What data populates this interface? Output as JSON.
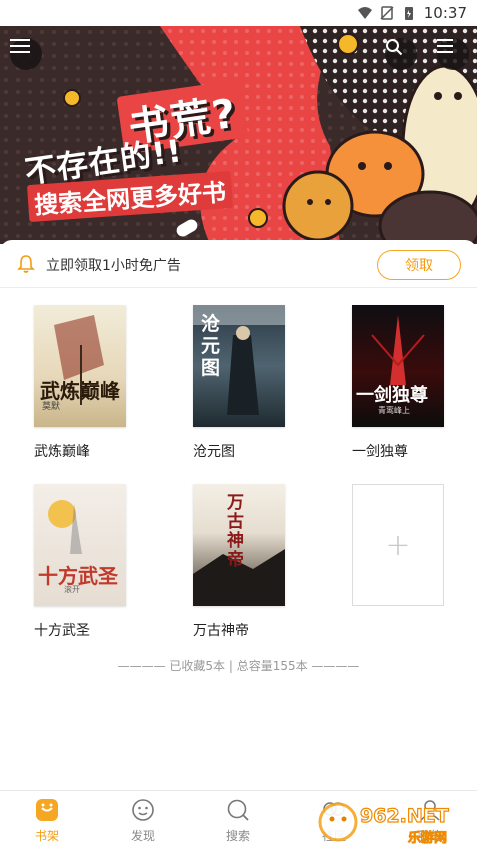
{
  "status_bar": {
    "time": "10:37",
    "icons": [
      "wifi-icon",
      "no-sim-icon",
      "battery-icon"
    ]
  },
  "banner": {
    "line1": "书荒?",
    "line2": "不存在的!!",
    "line3": "搜索全网更多好书",
    "buttons": [
      "menu-icon",
      "search-icon",
      "more-icon"
    ]
  },
  "notice": {
    "text": "立即领取1小时免广告",
    "button": "领取"
  },
  "books": [
    {
      "title": "武炼巅峰",
      "cover_text": "武炼巅峰",
      "cover_sub": "莫默"
    },
    {
      "title": "沧元图",
      "cover_text": "沧元图",
      "cover_sub": ""
    },
    {
      "title": "一剑独尊",
      "cover_text": "一剑独尊",
      "cover_sub": "青鸾峰上"
    },
    {
      "title": "十方武圣",
      "cover_text": "十方武圣",
      "cover_sub": "滚开"
    },
    {
      "title": "万古神帝",
      "cover_text": "万古神帝",
      "cover_sub": ""
    }
  ],
  "add_book": {
    "glyph": "+"
  },
  "summary": "———— 已收藏5本 | 总容量155本 ————",
  "bottom_nav": [
    {
      "label": "书架",
      "icon": "bookshelf-icon",
      "active": true
    },
    {
      "label": "发现",
      "icon": "discover-icon",
      "active": false
    },
    {
      "label": "搜索",
      "icon": "search-icon",
      "active": false
    },
    {
      "label": "社区",
      "icon": "community-icon",
      "active": false
    },
    {
      "label": "我的",
      "icon": "profile-icon",
      "active": false
    }
  ],
  "watermark": {
    "line1": "962.NET",
    "line2": "乐游网"
  },
  "colors": {
    "accent": "#f39c12",
    "banner_red": "#e94545",
    "banner_dark": "#3b2a2a"
  }
}
